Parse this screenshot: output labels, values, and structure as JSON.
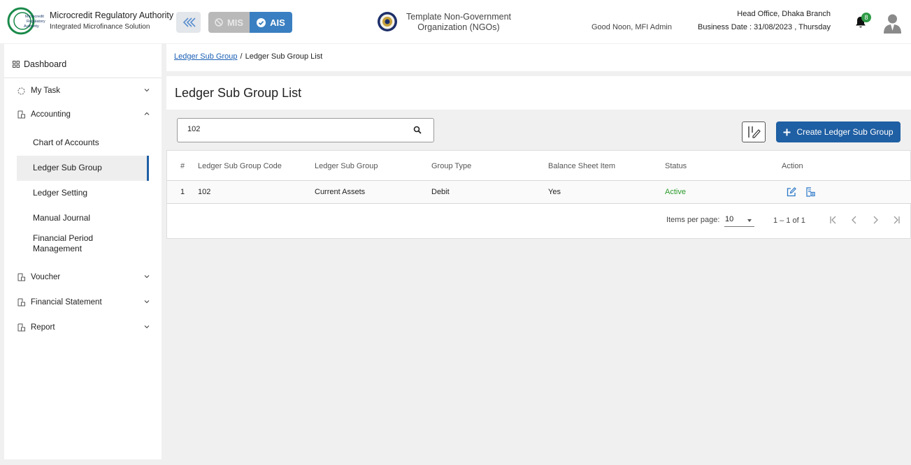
{
  "header": {
    "org_title": "Microcredit Regulatory Authority",
    "org_subtitle": "Integrated Microfinance Solution",
    "logo_text": "Microcredit Regulatory Authority",
    "mode_mis": "MIS",
    "mode_ais": "AIS",
    "org_name_line1": "Template Non-Government",
    "org_name_line2": "Organization (NGOs)",
    "greeting": "Good Noon, MFI Admin",
    "branch": "Head Office, Dhaka Branch",
    "business_date": "Business Date : 31/08/2023 , Thursday",
    "notification_count": "8"
  },
  "sidebar": {
    "dashboard": "Dashboard",
    "my_task": "My Task",
    "accounting": "Accounting",
    "accounting_items": [
      "Chart of Accounts",
      "Ledger Sub Group",
      "Ledger Setting",
      "Manual Journal"
    ],
    "financial_period_line1": "Financial Period",
    "financial_period_line2": "Management",
    "voucher": "Voucher",
    "financial_statement": "Financial Statement",
    "report": "Report",
    "active_item": "Ledger Sub Group"
  },
  "breadcrumb": {
    "parent": "Ledger Sub Group",
    "current": "Ledger Sub Group List"
  },
  "page": {
    "title": "Ledger Sub Group List",
    "search_value": "102",
    "create_button": "Create Ledger Sub Group"
  },
  "table": {
    "headers": [
      "#",
      "Ledger Sub Group Code",
      "Ledger Sub Group",
      "Group Type",
      "Balance Sheet Item",
      "Status",
      "Action"
    ],
    "rows": [
      {
        "index": "1",
        "code": "102",
        "sub_group": "Current Assets",
        "group_type": "Debit",
        "balance_sheet_item": "Yes",
        "status": "Active"
      }
    ]
  },
  "paginator": {
    "items_per_page_label": "Items per page:",
    "items_per_page": "10",
    "range": "1 – 1 of 1"
  },
  "colors": {
    "primary": "#1f5fa3",
    "ais_active": "#3a7fc1",
    "mis_inactive": "#b9b9b9",
    "status_active": "#2a9a2a",
    "badge": "#2e9b46"
  }
}
